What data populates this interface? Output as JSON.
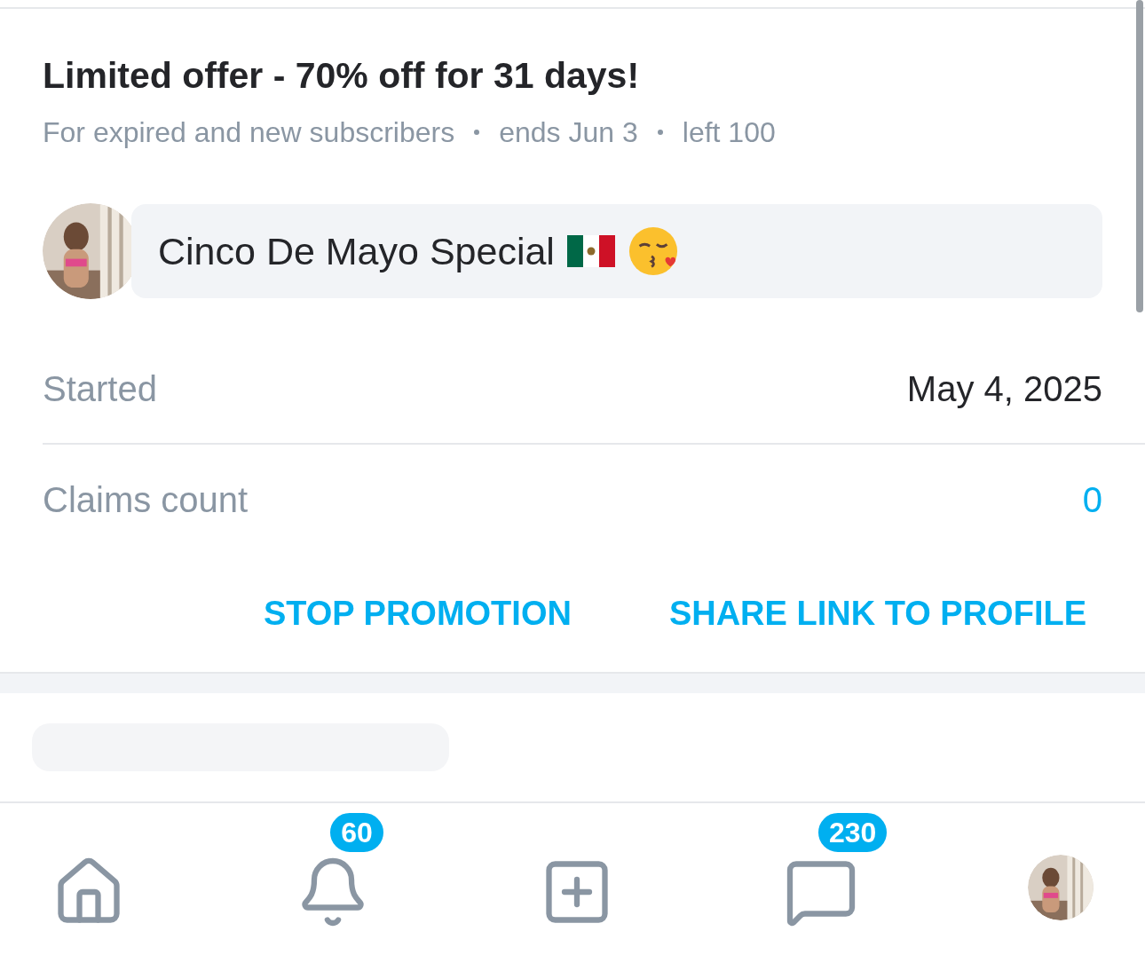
{
  "offer": {
    "title": "Limited offer - 70% off for 31 days!",
    "meta": [
      "For expired and new subscribers",
      "ends Jun 3",
      "left 100"
    ]
  },
  "campaign": {
    "label": "Cinco De Mayo Special"
  },
  "rows": [
    {
      "label": "Started",
      "value": "May 4, 2025",
      "kind": "plain"
    },
    {
      "label": "Claims count",
      "value": "0",
      "kind": "link"
    }
  ],
  "actions": [
    "STOP PROMOTION",
    "SHARE LINK TO PROFILE"
  ],
  "nav": [
    {
      "kind": "home"
    },
    {
      "kind": "bell",
      "badge": "60"
    },
    {
      "kind": "add"
    },
    {
      "kind": "message",
      "badge": "230"
    },
    {
      "kind": "avatar"
    }
  ]
}
